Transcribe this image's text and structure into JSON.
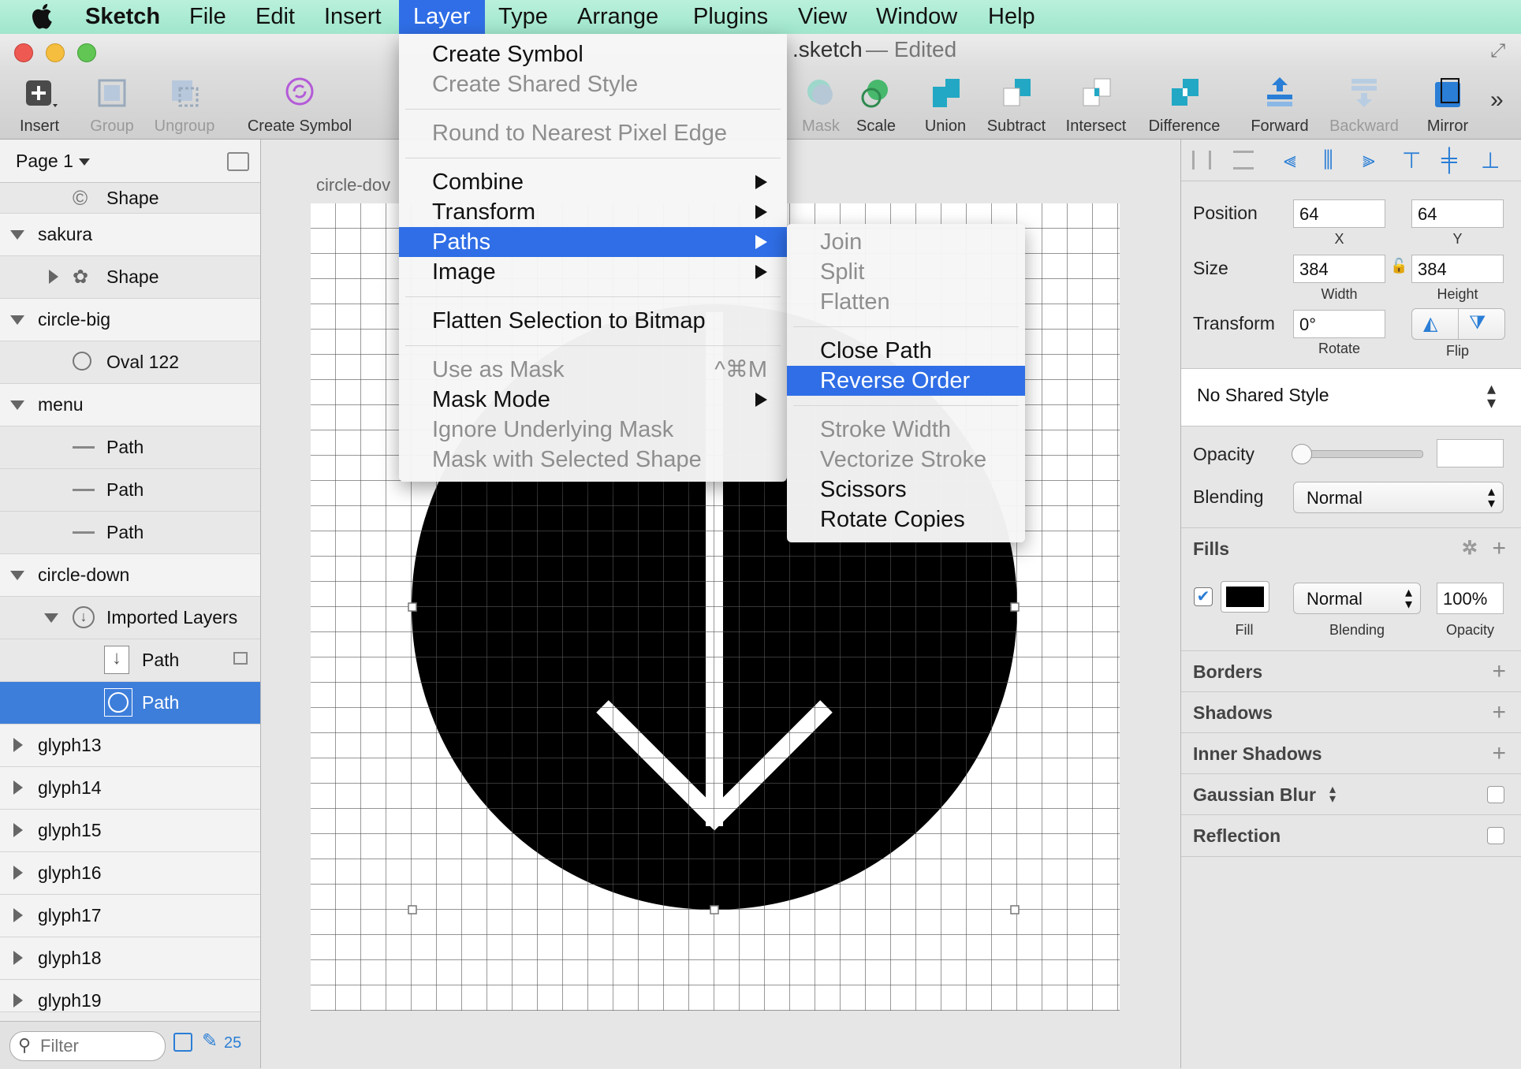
{
  "menubar": {
    "app": "Sketch",
    "items": [
      "File",
      "Edit",
      "Insert",
      "Layer",
      "Type",
      "Arrange",
      "Plugins",
      "View",
      "Window",
      "Help"
    ]
  },
  "window": {
    "title": ".sketch",
    "status": "— Edited"
  },
  "toolbar": {
    "insert": "Insert",
    "group": "Group",
    "ungroup": "Ungroup",
    "create_symbol": "Create Symbol",
    "mask": "Mask",
    "scale": "Scale",
    "union": "Union",
    "subtract": "Subtract",
    "intersect": "Intersect",
    "difference": "Difference",
    "forward": "Forward",
    "backward": "Backward",
    "mirror": "Mirror"
  },
  "sidebar": {
    "page": "Page 1",
    "layers": [
      {
        "label": "Shape"
      },
      {
        "label": "sakura"
      },
      {
        "label": "Shape"
      },
      {
        "label": "circle-big"
      },
      {
        "label": "Oval 122"
      },
      {
        "label": "menu"
      },
      {
        "label": "Path"
      },
      {
        "label": "Path"
      },
      {
        "label": "Path"
      },
      {
        "label": "circle-down"
      },
      {
        "label": "Imported Layers"
      },
      {
        "label": "Path"
      },
      {
        "label": "Path"
      },
      {
        "label": "glyph13"
      },
      {
        "label": "glyph14"
      },
      {
        "label": "glyph15"
      },
      {
        "label": "glyph16"
      },
      {
        "label": "glyph17"
      },
      {
        "label": "glyph18"
      },
      {
        "label": "glyph19"
      }
    ],
    "filter_placeholder": "Filter",
    "count": "25"
  },
  "canvas": {
    "artboard_label": "circle-dov"
  },
  "layer_menu": {
    "items": [
      {
        "label": "Create Symbol"
      },
      {
        "label": "Create Shared Style"
      },
      {
        "label": "Round to Nearest Pixel Edge"
      },
      {
        "label": "Combine"
      },
      {
        "label": "Transform"
      },
      {
        "label": "Paths"
      },
      {
        "label": "Image"
      },
      {
        "label": "Flatten Selection to Bitmap"
      },
      {
        "label": "Use as Mask",
        "shortcut": "^⌘M"
      },
      {
        "label": "Mask Mode"
      },
      {
        "label": "Ignore Underlying Mask"
      },
      {
        "label": "Mask with Selected Shape"
      }
    ]
  },
  "paths_menu": {
    "items": [
      {
        "label": "Join"
      },
      {
        "label": "Split"
      },
      {
        "label": "Flatten"
      },
      {
        "label": "Close Path"
      },
      {
        "label": "Reverse Order"
      },
      {
        "label": "Stroke Width"
      },
      {
        "label": "Vectorize Stroke"
      },
      {
        "label": "Scissors"
      },
      {
        "label": "Rotate Copies"
      }
    ]
  },
  "inspector": {
    "position_label": "Position",
    "x": "64",
    "y": "64",
    "x_label": "X",
    "y_label": "Y",
    "size_label": "Size",
    "width": "384",
    "height": "384",
    "width_label": "Width",
    "height_label": "Height",
    "transform_label": "Transform",
    "rotate": "0°",
    "rotate_label": "Rotate",
    "flip_label": "Flip",
    "shared_style": "No Shared Style",
    "opacity_label": "Opacity",
    "opacity_level": 0,
    "blending_label": "Blending",
    "blending": "Normal",
    "fills": {
      "title": "Fills",
      "fill_label": "Fill",
      "blending": "Normal",
      "blending_label": "Blending",
      "opacity": "100%",
      "opacity_label": "Opacity",
      "color": "#000000",
      "enabled": true
    },
    "sections": [
      "Borders",
      "Shadows",
      "Inner Shadows",
      "Gaussian Blur",
      "Reflection"
    ]
  },
  "colors": {
    "accent": "#2f6ee6",
    "selection": "#3d7edb",
    "menubar": "#a8ead2"
  }
}
